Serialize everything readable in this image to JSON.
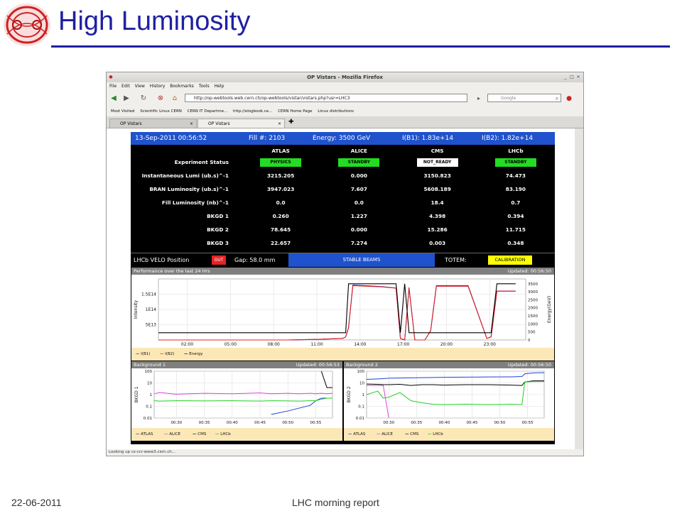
{
  "slide": {
    "title": "High Luminosity",
    "footer_date": "22-06-2011",
    "footer_center": "LHC morning report"
  },
  "browser": {
    "window_title": "OP Vistars - Mozilla Firefox",
    "menu": [
      "File",
      "Edit",
      "View",
      "History",
      "Bookmarks",
      "Tools",
      "Help"
    ],
    "url": "http://op-webtools.web.cern.ch/op-webtools/vistar/vistars.php?usr=LHC3",
    "search_placeholder": "Google",
    "bookmarks": [
      "Most Visited",
      "Scientific Linux CERN",
      "CERN IT Departme...",
      "http://elogbook.ce...",
      "CERN Home Page",
      "Linux distributions"
    ],
    "tabs": [
      {
        "label": "OP Vistars"
      },
      {
        "label": "OP Vistars"
      }
    ],
    "status_text": "Looking up cs-ccr-www3.cern.ch..."
  },
  "vistar": {
    "datetime": "13-Sep-2011 00:56:52",
    "fill": "Fill #: 2103",
    "energy": "Energy: 3500 GeV",
    "ib1": "I(B1): 1.83e+14",
    "ib2": "I(B2): 1.82e+14",
    "experiments": [
      "ATLAS",
      "ALICE",
      "CMS",
      "LHCb"
    ],
    "status_label": "Experiment Status",
    "statuses": [
      {
        "text": "PHYSICS",
        "color": "#22dd22"
      },
      {
        "text": "STANDBY",
        "color": "#22dd22"
      },
      {
        "text": "NOT_READY",
        "color": "#ffffff"
      },
      {
        "text": "STANDBY",
        "color": "#22dd22"
      }
    ],
    "rows": [
      {
        "label": "Instantaneous Lumi (ub.s)^-1",
        "values": [
          "3215.205",
          "0.000",
          "3150.823",
          "74.473"
        ]
      },
      {
        "label": "BRAN Luminosity (ub.s)^-1",
        "values": [
          "3947.023",
          "7.607",
          "5608.189",
          "83.190"
        ]
      },
      {
        "label": "Fill Luminosity (nb)^-1",
        "values": [
          "0.0",
          "0.0",
          "18.4",
          "0.7"
        ]
      },
      {
        "label": "BKGD 1",
        "values": [
          "0.260",
          "1.227",
          "4.398",
          "0.394"
        ]
      },
      {
        "label": "BKGD 2",
        "values": [
          "78.645",
          "0.000",
          "15.286",
          "11.715"
        ]
      },
      {
        "label": "BKGD 3",
        "values": [
          "22.657",
          "7.274",
          "0.003",
          "0.348"
        ]
      }
    ],
    "velo_label": "LHCb VELO Position",
    "velo_state": "OUT",
    "gap": "Gap: 58.0 mm",
    "beam_mode": "STABLE BEAMS",
    "totem_label": "TOTEM:",
    "totem_state": "CALIBRATION",
    "colors": {
      "b1": "#1f3fd6",
      "b2": "#e42020",
      "energy": "#000000",
      "atlas": "#1f3fd6",
      "alice": "#e040e0",
      "cms": "#000000",
      "lhcb": "#22cc22"
    }
  },
  "chart_data": [
    {
      "type": "line",
      "title": "Performance over the last 24 Hrs",
      "updated": "Updated: 00:56:50",
      "ylabel": "Intensity",
      "y2label": "Energy(GeV)",
      "x_ticks": [
        "02:00",
        "05:00",
        "08:00",
        "11:00",
        "14:00",
        "17:00",
        "20:00",
        "23:00"
      ],
      "y_ticks": [
        "5E13",
        "1E14",
        "1.5E14"
      ],
      "y2_ticks": [
        "0",
        "500",
        "1000",
        "1500",
        "2000",
        "2500",
        "3000",
        "3500"
      ],
      "legend": [
        "I(B1)",
        "I(B2)",
        "Energy"
      ],
      "x_hours": [
        0,
        2,
        4,
        6,
        8,
        9,
        9.5,
        10,
        11,
        12.8,
        13.0,
        13.2,
        13.5,
        15.5,
        16.5,
        16.8,
        17.1,
        17.4,
        17.8,
        18.5,
        18.9,
        19.3,
        21.5,
        22.8,
        23.1,
        23.5,
        24.8
      ],
      "series": [
        {
          "name": "I(B1)",
          "values": [
            0,
            0,
            0,
            0,
            0,
            0,
            0.005,
            0.01,
            0.02,
            0.05,
            0.1,
            0.4,
            1.8,
            1.75,
            1.7,
            0.05,
            0,
            1.72,
            0,
            0,
            0.3,
            1.78,
            1.78,
            0.05,
            0.1,
            1.6,
            1.6
          ]
        },
        {
          "name": "I(B2)",
          "values": [
            0,
            0,
            0,
            0,
            0,
            0,
            0.005,
            0.01,
            0.02,
            0.05,
            0.1,
            0.4,
            1.78,
            1.74,
            1.7,
            0.05,
            0,
            1.7,
            0,
            0,
            0.3,
            1.76,
            1.76,
            0.05,
            0.1,
            1.6,
            1.6
          ]
        },
        {
          "name": "Energy",
          "values": [
            450,
            450,
            450,
            450,
            450,
            450,
            450,
            450,
            450,
            450,
            450,
            3500,
            3500,
            3500,
            3500,
            450,
            3500,
            450,
            450,
            450,
            450,
            450,
            450,
            450,
            450,
            3500,
            3500
          ]
        }
      ]
    },
    {
      "type": "line",
      "title": "Background 1",
      "updated": "Updated: 00:56:53",
      "ylabel": "BKGD 1",
      "y_scale": "log",
      "x_ticks": [
        "00:30",
        "00:35",
        "00:40",
        "00:45",
        "00:50",
        "00:55"
      ],
      "y_ticks": [
        "0.01",
        "0.1",
        "1",
        "10",
        "100"
      ],
      "legend": [
        "ATLAS",
        "ALICE",
        "CMS",
        "LHCb"
      ],
      "x_min": [
        26,
        27,
        30,
        35,
        40,
        45,
        47,
        50,
        52,
        54,
        55,
        56,
        57,
        58
      ],
      "series": [
        {
          "name": "ATLAS",
          "values": [
            null,
            null,
            null,
            null,
            null,
            null,
            0.02,
            0.04,
            0.07,
            0.12,
            0.3,
            0.5,
            0.5,
            0.5
          ]
        },
        {
          "name": "ALICE",
          "values": [
            1.2,
            1.5,
            1.1,
            1.3,
            1.2,
            1.4,
            1.2,
            1.3,
            1.2,
            1.3,
            1.2,
            1.3,
            1.2,
            1.3
          ]
        },
        {
          "name": "CMS",
          "values": [
            null,
            null,
            null,
            null,
            null,
            null,
            null,
            null,
            null,
            null,
            null,
            100,
            4,
            4
          ]
        },
        {
          "name": "LHCb",
          "values": [
            0.3,
            0.28,
            0.3,
            0.29,
            0.3,
            0.28,
            0.3,
            0.29,
            0.28,
            0.3,
            0.3,
            0.4,
            0.5,
            0.5
          ]
        }
      ]
    },
    {
      "type": "line",
      "title": "Background 2",
      "updated": "Updated: 00:56:50",
      "ylabel": "BKGD 2",
      "y_scale": "log",
      "x_ticks": [
        "00:30",
        "00:35",
        "00:40",
        "00:45",
        "00:50",
        "00:55"
      ],
      "y_ticks": [
        "0.01",
        "0.1",
        "1",
        "10",
        "100"
      ],
      "legend": [
        "ATLAS",
        "ALICE",
        "CMS",
        "LHCb"
      ],
      "x_min": [
        26,
        28,
        29,
        30,
        32,
        34,
        36,
        38,
        40,
        44,
        48,
        52,
        54,
        54.5,
        56,
        58
      ],
      "series": [
        {
          "name": "ATLAS",
          "values": [
            20,
            22,
            23,
            25,
            26,
            27,
            28,
            29,
            30,
            31,
            32,
            33,
            35,
            60,
            70,
            75
          ]
        },
        {
          "name": "ALICE",
          "values": [
            6,
            6,
            6,
            0.001,
            null,
            null,
            null,
            null,
            null,
            null,
            null,
            null,
            null,
            null,
            null,
            null
          ]
        },
        {
          "name": "CMS",
          "values": [
            8,
            7.5,
            7,
            7,
            7.5,
            6,
            7,
            7,
            6.5,
            7,
            7,
            6.5,
            6,
            12,
            15,
            15
          ]
        },
        {
          "name": "LHCb",
          "values": [
            1,
            2,
            0.5,
            0.6,
            1.5,
            0.3,
            0.2,
            0.15,
            0.14,
            0.15,
            0.14,
            0.15,
            0.14,
            12,
            13,
            13
          ]
        }
      ]
    }
  ]
}
